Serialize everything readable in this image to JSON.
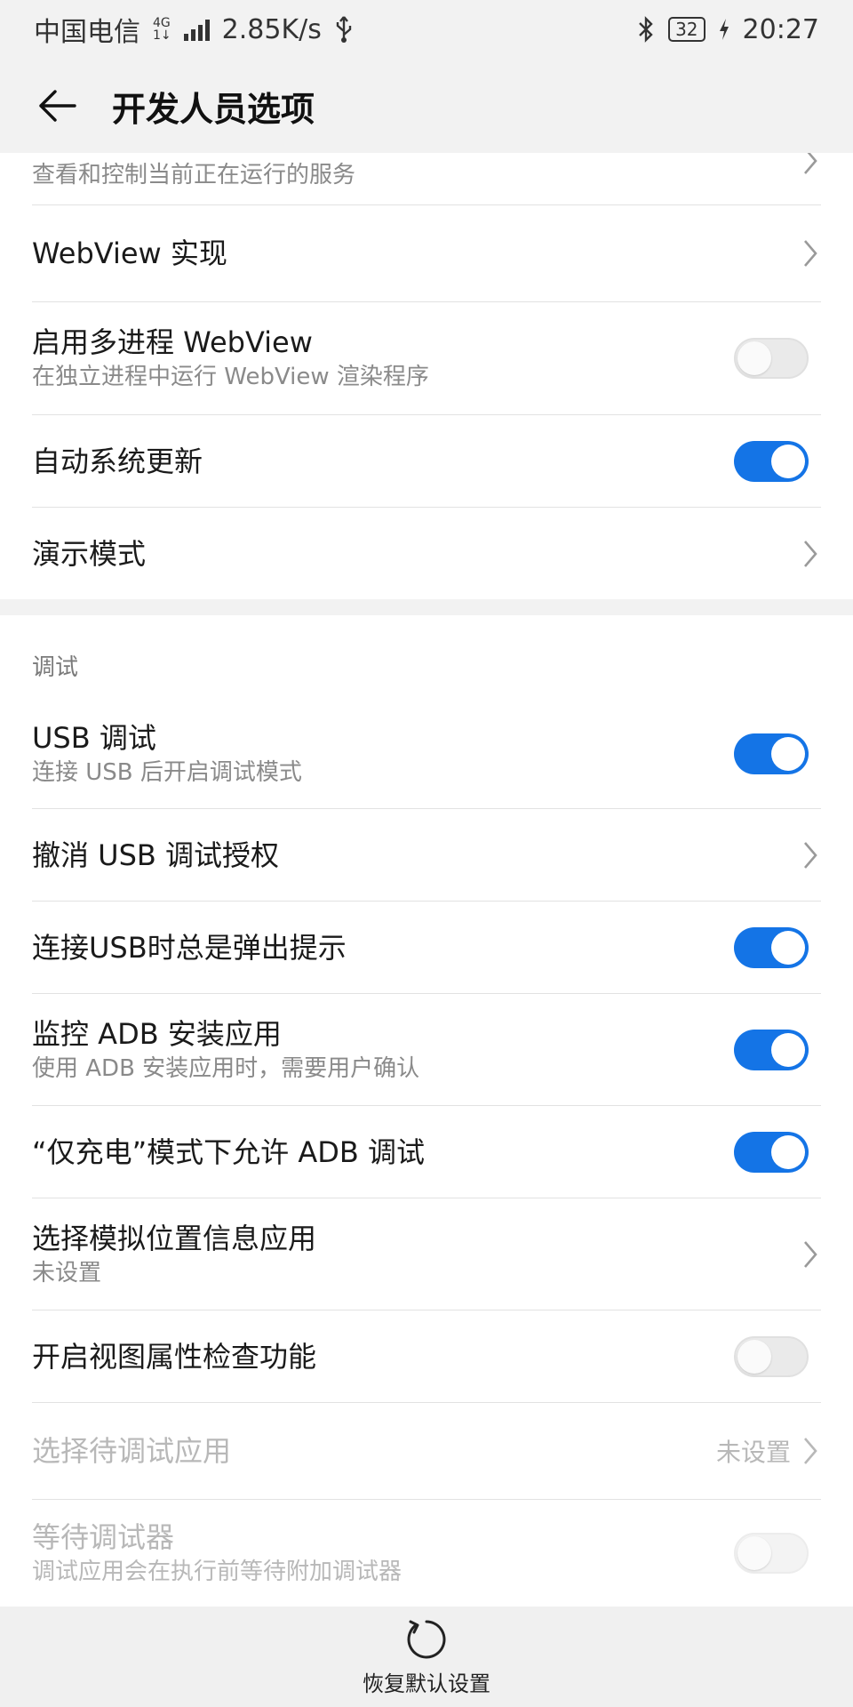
{
  "status_bar": {
    "carrier": "中国电信",
    "network_badge_top": "4G",
    "network_badge_bottom": "1↓",
    "speed": "2.85K/s",
    "battery": "32",
    "time": "20:27"
  },
  "app_bar": {
    "title": "开发人员选项"
  },
  "items": [
    {
      "title": "",
      "subtitle": "查看和控制当前正在运行的服务",
      "control": "chevron"
    },
    {
      "title": "WebView 实现",
      "control": "chevron"
    },
    {
      "title": "启用多进程 WebView",
      "subtitle": "在独立进程中运行 WebView 渲染程序",
      "control": "toggle",
      "state": "off"
    },
    {
      "title": "自动系统更新",
      "control": "toggle",
      "state": "on"
    },
    {
      "title": "演示模式",
      "control": "chevron"
    }
  ],
  "debug_section": {
    "header": "调试",
    "items": [
      {
        "title": "USB 调试",
        "subtitle": "连接 USB 后开启调试模式",
        "control": "toggle",
        "state": "on"
      },
      {
        "title": "撤消 USB 调试授权",
        "control": "chevron"
      },
      {
        "title": "连接USB时总是弹出提示",
        "control": "toggle",
        "state": "on"
      },
      {
        "title": "监控 ADB 安装应用",
        "subtitle": "使用 ADB 安装应用时，需要用户确认",
        "control": "toggle",
        "state": "on"
      },
      {
        "title": "“仅充电”模式下允许 ADB 调试",
        "control": "toggle",
        "state": "on"
      },
      {
        "title": "选择模拟位置信息应用",
        "subtitle": "未设置",
        "control": "chevron"
      },
      {
        "title": "开启视图属性检查功能",
        "control": "toggle",
        "state": "off"
      },
      {
        "title": "选择待调试应用",
        "value": "未设置",
        "control": "chevron",
        "disabled": true
      },
      {
        "title": "等待调试器",
        "subtitle": "调试应用会在执行前等待附加调试器",
        "control": "toggle",
        "state": "off",
        "disabled": true
      }
    ]
  },
  "bottom": {
    "reset_label": "恢复默认设置"
  },
  "colors": {
    "accent": "#1474e6",
    "bar_bg": "#f2f2f2"
  }
}
